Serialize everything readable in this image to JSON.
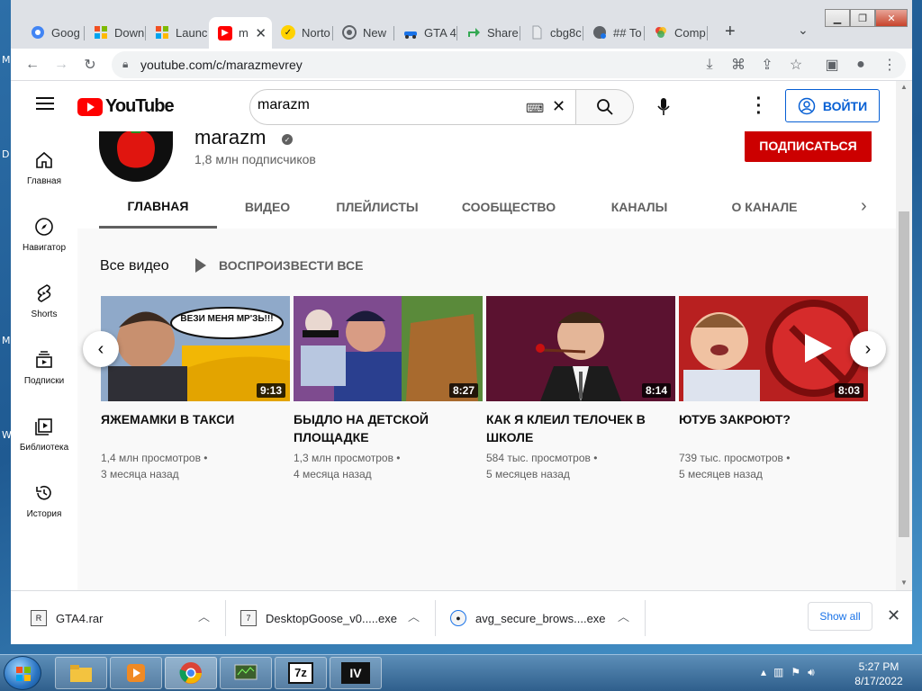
{
  "desktop": {
    "edge_fragments": [
      "M",
      "D",
      "M",
      "W"
    ]
  },
  "browser": {
    "tabs": [
      {
        "label": "Goog",
        "icon": "google-icon"
      },
      {
        "label": "Down",
        "icon": "windows-icon"
      },
      {
        "label": "Launc",
        "icon": "windows-icon"
      },
      {
        "label": "m",
        "icon": "youtube-icon",
        "active": true
      },
      {
        "label": "Norto",
        "icon": "norton-icon"
      },
      {
        "label": "New",
        "icon": "chrome-icon"
      },
      {
        "label": "GTA 4",
        "icon": "car-icon"
      },
      {
        "label": "Share",
        "icon": "share-icon"
      },
      {
        "label": "cbg8c",
        "icon": "file-icon"
      },
      {
        "label": "## To",
        "icon": "globe-icon"
      },
      {
        "label": "Comp",
        "icon": "colorwheel-icon"
      }
    ],
    "url": "youtube.com/c/marazmevrey"
  },
  "youtube": {
    "logo_text": "YouTube",
    "search_value": "marazm",
    "signin_label": "ВОЙТИ",
    "nav": [
      {
        "label": "Главная",
        "icon": "home-icon"
      },
      {
        "label": "Навигатор",
        "icon": "compass-icon"
      },
      {
        "label": "Shorts",
        "icon": "shorts-icon"
      },
      {
        "label": "Подписки",
        "icon": "subscriptions-icon"
      },
      {
        "label": "Библиотека",
        "icon": "library-icon"
      },
      {
        "label": "История",
        "icon": "history-icon"
      }
    ],
    "channel": {
      "name": "marazm",
      "subscribers": "1,8 млн подписчиков",
      "subscribe_label": "ПОДПИСАТЬСЯ"
    },
    "channel_tabs": [
      "ГЛАВНАЯ",
      "ВИДЕО",
      "ПЛЕЙЛИСТЫ",
      "СООБЩЕСТВО",
      "КАНАЛЫ",
      "О КАНАЛЕ"
    ],
    "shelf": {
      "title": "Все видео",
      "play_all": "ВОСПРОИЗВЕСТИ ВСЕ"
    },
    "videos": [
      {
        "title": "ЯЖЕМАМКИ В ТАКСИ",
        "views": "1,4 млн просмотров",
        "age": "3 месяца назад",
        "duration": "9:13",
        "bubble": "ВЕЗИ МЕНЯ МР'ЗЬ!!!"
      },
      {
        "title": "БЫДЛО НА ДЕТСКОЙ ПЛОЩАДКЕ",
        "views": "1,3 млн просмотров",
        "age": "4 месяца назад",
        "duration": "8:27"
      },
      {
        "title": "КАК Я КЛЕИЛ ТЕЛОЧЕК В ШКОЛЕ",
        "views": "584 тыс. просмотров",
        "age": "5 месяцев назад",
        "duration": "8:14"
      },
      {
        "title": "ЮТУБ ЗАКРОЮТ?",
        "views": "739 тыс. просмотров",
        "age": "5 месяцев назад",
        "duration": "8:03"
      }
    ],
    "meta_separator": "•"
  },
  "downloads": {
    "items": [
      {
        "name": "GTA4.rar",
        "icon": "rar-icon"
      },
      {
        "name": "DesktopGoose_v0.....exe",
        "icon": "7z-icon"
      },
      {
        "name": "avg_secure_brows....exe",
        "icon": "avg-icon"
      }
    ],
    "show_all": "Show all"
  },
  "taskbar": {
    "time": "5:27 PM",
    "date": "8/17/2022",
    "app_labels": [
      "7z",
      "IV"
    ]
  },
  "colors": {
    "yt_red": "#ff0000",
    "subscribe_red": "#cc0000",
    "link_blue": "#065fd4"
  }
}
